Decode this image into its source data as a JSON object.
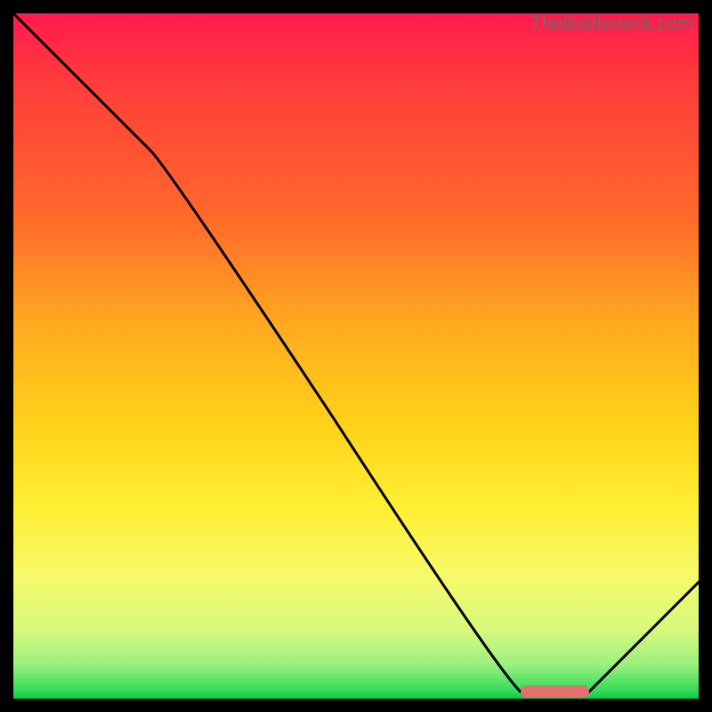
{
  "watermark": "TheBottleneck.com",
  "colors": {
    "gradient_top": "#ff1a4d",
    "gradient_bottom": "#0fc746",
    "curve": "#000000",
    "marker": "#e2706f",
    "frame_bg": "#000000"
  },
  "chart_data": {
    "type": "line",
    "title": "",
    "xlabel": "",
    "ylabel": "",
    "xlim": [
      0,
      100
    ],
    "ylim": [
      0,
      100
    ],
    "legend": false,
    "grid": false,
    "annotations": [
      {
        "kind": "watermark",
        "text": "TheBottleneck.com",
        "position": "top-right"
      },
      {
        "kind": "marker",
        "shape": "pill",
        "x_start": 74,
        "x_end": 84,
        "y": 1,
        "color": "#e2706f"
      }
    ],
    "series": [
      {
        "name": "bottleneck-curve",
        "x": [
          0,
          20,
          74,
          84,
          100
        ],
        "y": [
          100,
          80,
          1,
          1,
          17
        ]
      }
    ]
  }
}
